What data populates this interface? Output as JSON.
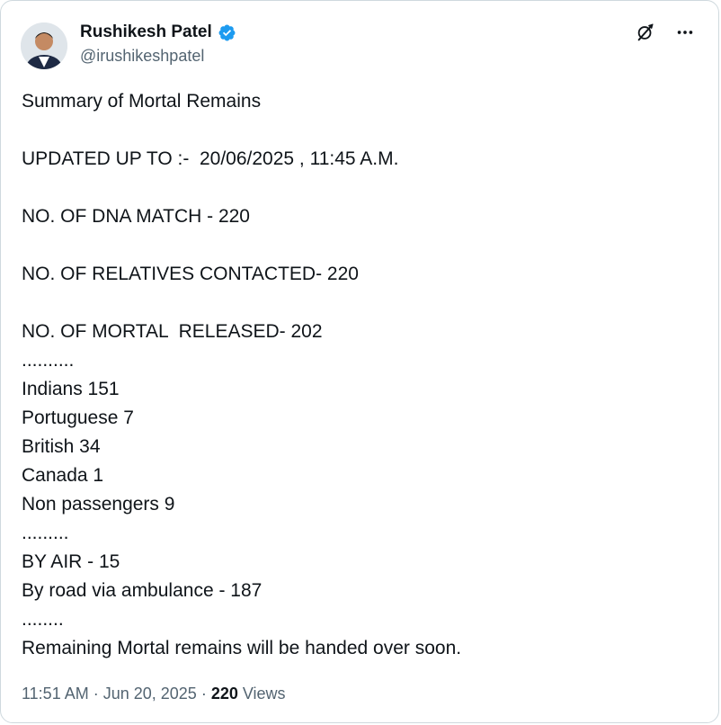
{
  "author": {
    "display_name": "Rushikesh Patel",
    "handle": "@irushikeshpatel",
    "verified": true,
    "avatar_icon": "profile-photo",
    "verified_color": "#1d9bf0"
  },
  "actions": {
    "grok_icon": "grok-icon",
    "more_icon": "more-icon"
  },
  "post": {
    "lines": [
      "Summary of Mortal Remains",
      "",
      "UPDATED UP TO :-  20/06/2025 , 11:45 A.M.",
      "",
      "NO. OF DNA MATCH - 220",
      "",
      "NO. OF RELATIVES CONTACTED- 220",
      "",
      "NO. OF MORTAL  RELEASED- 202",
      "..........",
      "Indians 151",
      "Portuguese 7",
      "British 34",
      "Canada 1",
      "Non passengers 9",
      ".........",
      "BY AIR - 15",
      "By road via ambulance - 187",
      "........",
      "Remaining Mortal remains will be handed over soon."
    ]
  },
  "meta": {
    "time": "11:51 AM",
    "separator": " · ",
    "date": "Jun 20, 2025",
    "views_count": "220",
    "views_label": " Views"
  },
  "colors": {
    "text": "#0f1419",
    "secondary": "#536471",
    "border": "#cfd9de"
  }
}
